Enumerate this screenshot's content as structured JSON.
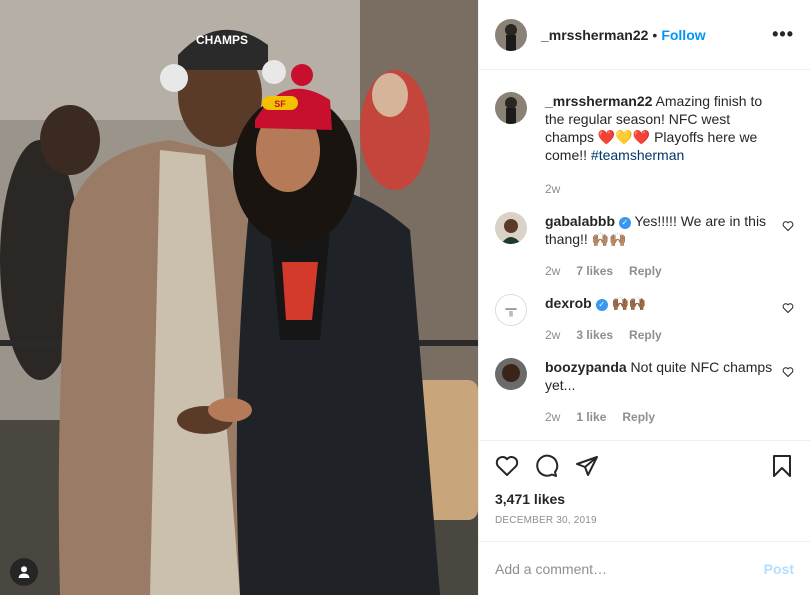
{
  "post": {
    "author": "_mrssherman22",
    "follow_label": "Follow",
    "dot": "•",
    "more_label": "•••",
    "likes": "3,471 likes",
    "date": "DECEMBER 30, 2019",
    "add_comment_placeholder": "Add a comment…",
    "post_label": "Post",
    "photo_hat_text": "CHAMPS",
    "photo_hat_logo": "SF"
  },
  "caption": {
    "user": "_mrssherman22",
    "text": " Amazing finish to the regular season! NFC west champs ❤️💛❤️ Playoffs here we come!! ",
    "hashtag": "#teamsherman",
    "age": "2w"
  },
  "comments": [
    {
      "user": "gabalabbb",
      "verified": true,
      "text": " Yes!!!!! We are in this thang!! 🙌🏽🙌🏽",
      "age": "2w",
      "likes": "7 likes",
      "reply": "Reply"
    },
    {
      "user": "dexrob",
      "verified": true,
      "text": " 🙌🏾🙌🏾",
      "age": "2w",
      "likes": "3 likes",
      "reply": "Reply"
    },
    {
      "user": "boozypanda",
      "verified": false,
      "text": " Not quite NFC champs yet...",
      "age": "2w",
      "likes": "1 like",
      "reply": "Reply"
    }
  ],
  "colors": {
    "accent": "#0095f6",
    "muted": "#8e8e8e",
    "post_disabled": "#b2dffc"
  }
}
